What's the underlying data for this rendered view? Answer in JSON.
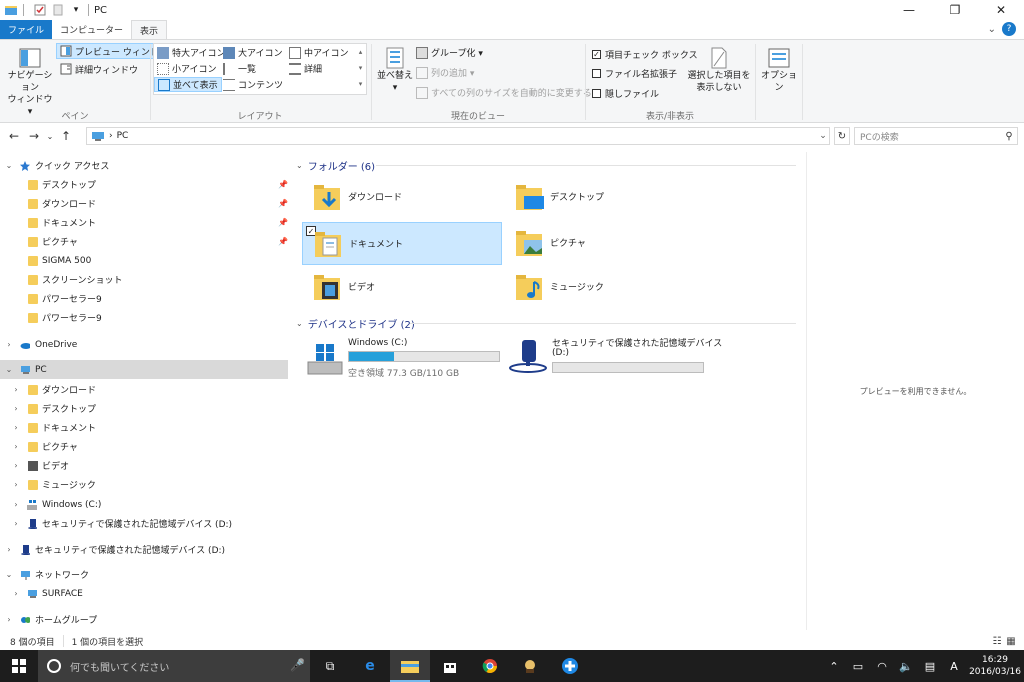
{
  "window": {
    "title": "PC",
    "controls": {
      "minimize": "—",
      "maximize": "❐",
      "close": "✕"
    }
  },
  "ribbon": {
    "tabs": [
      "ファイル",
      "コンピューター",
      "表示"
    ],
    "help": "?",
    "groups": {
      "pane": {
        "label": "ペイン",
        "nav_pane_line1": "ナビゲーション",
        "nav_pane_line2": "ウィンドウ▾",
        "preview": "プレビュー ウィンドウ",
        "details": "詳細ウィンドウ"
      },
      "layout": {
        "label": "レイアウト",
        "items": [
          "特大アイコン",
          "大アイコン",
          "中アイコン",
          "小アイコン",
          "一覧",
          "詳細",
          "並べて表示",
          "コンテンツ"
        ]
      },
      "current_view": {
        "label": "現在のビュー",
        "sort_line1": "並べ替え",
        "sort_line2": "▾",
        "group_by": "グループ化 ▾",
        "add_columns": "列の追加 ▾",
        "fit_columns": "すべての列のサイズを自動的に変更する"
      },
      "show_hide": {
        "label": "表示/非表示",
        "item_checkboxes": "項目チェック ボックス",
        "file_extensions": "ファイル名拡張子",
        "hidden_items": "隠しファイル",
        "hide_selected_line1": "選択した項目を",
        "hide_selected_line2": "表示しない"
      },
      "options": {
        "label": "オプション"
      }
    }
  },
  "address": {
    "path": "PC",
    "search_placeholder": "PCの検索"
  },
  "nav_pane": {
    "quick_access": "クイック アクセス",
    "quick_items": [
      "デスクトップ",
      "ダウンロード",
      "ドキュメント",
      "ピクチャ",
      "SIGMA 500",
      "スクリーンショット",
      "パワーセラー9",
      "パワーセラー9"
    ],
    "onedrive": "OneDrive",
    "pc": "PC",
    "pc_items": [
      "ダウンロード",
      "デスクトップ",
      "ドキュメント",
      "ピクチャ",
      "ビデオ",
      "ミュージック",
      "Windows (C:)",
      "セキュリティで保護された記憶域デバイス (D:)"
    ],
    "secure_device": "セキュリティで保護された記憶域デバイス (D:)",
    "network": "ネットワーク",
    "network_items": [
      "SURFACE"
    ],
    "homegroup": "ホームグループ"
  },
  "content": {
    "folders_header": "フォルダー (6)",
    "folders": [
      "ダウンロード",
      "デスクトップ",
      "ドキュメント",
      "ピクチャ",
      "ビデオ",
      "ミュージック"
    ],
    "devices_header": "デバイスとドライブ (2)",
    "drive_c": {
      "name": "Windows (C:)",
      "free": "空き領域 77.3 GB/110 GB",
      "used_fraction": 0.297
    },
    "drive_d": {
      "name_line1": "セキュリティで保護された記憶域デバイス",
      "name_line2": "(D:)",
      "used_fraction": 0
    }
  },
  "preview": {
    "message": "プレビューを利用できません。"
  },
  "status": {
    "item_count": "8 個の項目",
    "selected": "1 個の項目を選択"
  },
  "taskbar": {
    "search_placeholder": "何でも聞いてください",
    "ime": "A",
    "time": "16:29",
    "date": "2016/03/16"
  },
  "colors": {
    "accent": "#1979ca",
    "selection": "#cce8ff",
    "folder": "#f5cd5b",
    "drive_fill": "#26a0da",
    "taskbar": "#1d1d1d"
  }
}
